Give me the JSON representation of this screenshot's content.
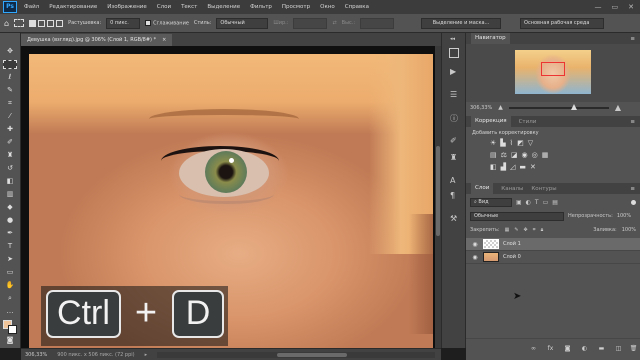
{
  "menu": {
    "app_logo": "Ps",
    "items": [
      "Файл",
      "Редактирование",
      "Изображение",
      "Слои",
      "Текст",
      "Выделение",
      "Фильтр",
      "Просмотр",
      "Окно",
      "Справка"
    ],
    "window_controls": [
      "—",
      "▭",
      "✕"
    ]
  },
  "options": {
    "feather_label": "Растушевка:",
    "feather_value": "0 пикс.",
    "antialias_label": "Сглаживание",
    "style_label": "Стиль:",
    "style_value": "Обычный",
    "width_label": "Шир.:",
    "height_label": "Выс.:",
    "refine_button": "Выделение и маска...",
    "workspace_value": "Основная рабочая среда"
  },
  "document": {
    "tab_title": "Девушка (взгляд).jpg @ 306% (Слой 1, RGB/8#) *",
    "tab_close": "×"
  },
  "status": {
    "zoom": "306,33%",
    "doc_size": "900 пикс. x 506 пикс. (72 ppi)"
  },
  "navigator": {
    "tab": "Навигатор",
    "zoom": "306,33%"
  },
  "adjustments": {
    "tab_active": "Коррекция",
    "tab_inactive": "Стили",
    "add_label": "Добавить корректировку"
  },
  "layers": {
    "tabs": [
      "Слои",
      "Каналы",
      "Контуры"
    ],
    "filter_value": "Вид",
    "blend_mode": "Обычные",
    "opacity_label": "Непрозрачность:",
    "opacity_value": "100%",
    "lock_label": "Закрепить:",
    "fill_label": "Заливка:",
    "fill_value": "100%",
    "list": [
      {
        "name": "Слой 1",
        "selected": true
      },
      {
        "name": "Слой 0",
        "selected": false
      }
    ],
    "footer_icons": [
      "link-icon",
      "fx-icon",
      "mask-icon",
      "adjustment-icon",
      "folder-icon",
      "new-layer-icon",
      "trash-icon"
    ]
  },
  "overlay": {
    "key1": "Ctrl",
    "plus": "+",
    "key2": "D"
  },
  "colors": {
    "app_bg": "#535353",
    "panel_dark": "#424242",
    "ps_blue": "#31a8ff",
    "selected_layer": "#6a6a6a"
  }
}
